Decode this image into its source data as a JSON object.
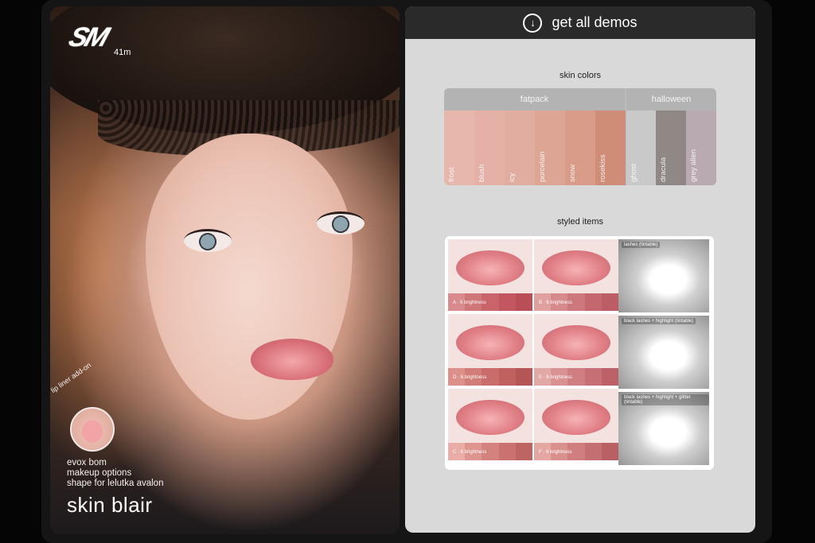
{
  "brand": {
    "logo_text": "SM",
    "sub": "41m"
  },
  "promo": {
    "addon_label": "lip liner add-on",
    "features": [
      "evox bom",
      "makeup options",
      "shape for lelutka avalon"
    ],
    "title": "skin blair"
  },
  "demos": {
    "label": "get all demos",
    "icon": "download-circle-icon"
  },
  "skin_colors": {
    "title": "skin colors",
    "groups": [
      {
        "name": "fatpack"
      },
      {
        "name": "halloween"
      }
    ],
    "swatches": [
      {
        "name": "frost",
        "color": "#e7b7ac"
      },
      {
        "name": "blush",
        "color": "#e5b1a6"
      },
      {
        "name": "icy",
        "color": "#e1ada0"
      },
      {
        "name": "porcelain",
        "color": "#dda594"
      },
      {
        "name": "snow",
        "color": "#d99c88"
      },
      {
        "name": "rosekiss",
        "color": "#cf8d77"
      },
      {
        "name": "ghost",
        "color": "#c9c9c9"
      },
      {
        "name": "dracula",
        "color": "#8f8885"
      },
      {
        "name": "grey alien",
        "color": "#b9a9b1"
      }
    ]
  },
  "styled_items": {
    "title": "styled items",
    "lip_tiles": [
      {
        "tag": "A · 6 brightness",
        "shades": [
          "#d88a8c",
          "#cf7678",
          "#c8646a",
          "#c2575f",
          "#b94e57"
        ]
      },
      {
        "tag": "B · 6 brightness",
        "shades": [
          "#e0a09f",
          "#d68a8c",
          "#cd787c",
          "#c4676f",
          "#bc5c65"
        ]
      },
      {
        "tag": "D · 6 brightness",
        "shades": [
          "#dd8f89",
          "#d27d78",
          "#c96c6b",
          "#c0615f",
          "#b65556"
        ]
      },
      {
        "tag": "E · 6 brightness",
        "shades": [
          "#e2a8a6",
          "#d99192",
          "#cf7e82",
          "#c66f74",
          "#bd6168"
        ]
      },
      {
        "tag": "C · 6 brightness",
        "shades": [
          "#e9aca6",
          "#de958f",
          "#d3827e",
          "#c9726f",
          "#be6462"
        ]
      },
      {
        "tag": "F · 6 brightness",
        "shades": [
          "#e4a7a2",
          "#d9918e",
          "#ce7f7e",
          "#c46f71",
          "#b96065"
        ]
      }
    ],
    "lash_tiles": [
      {
        "label": "lashes (tintable)"
      },
      {
        "label": "black lashes + highlight (tintable)"
      },
      {
        "label": "black lashes + highlight + glitter (tintable)"
      }
    ]
  }
}
